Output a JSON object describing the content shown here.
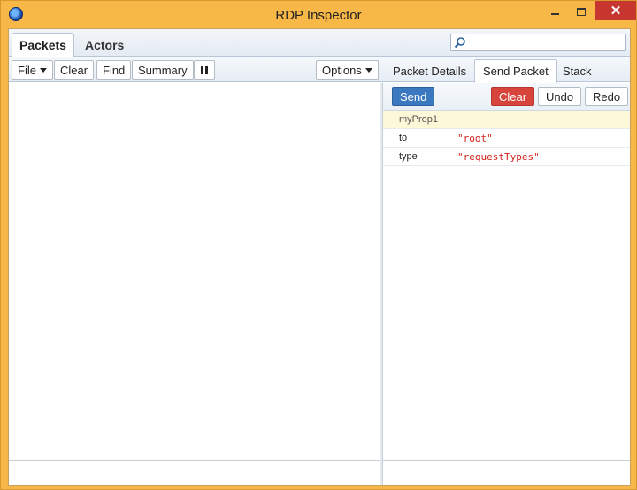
{
  "window": {
    "title": "RDP Inspector",
    "close_glyph": "✕"
  },
  "main_tabs": [
    {
      "label": "Packets"
    },
    {
      "label": "Actors"
    }
  ],
  "search": {
    "placeholder": ""
  },
  "toolbar": {
    "file_label": "File",
    "clear_label": "Clear",
    "find_label": "Find",
    "summary_label": "Summary",
    "options_label": "Options"
  },
  "side_tabs": [
    {
      "label": "Packet Details"
    },
    {
      "label": "Send Packet"
    },
    {
      "label": "Stack"
    }
  ],
  "send_panel": {
    "send_label": "Send",
    "clear_label": "Clear",
    "undo_label": "Undo",
    "redo_label": "Redo",
    "new_prop_placeholder": "myProp1",
    "props": [
      {
        "key": "to",
        "value": "\"root\""
      },
      {
        "key": "type",
        "value": "\"requestTypes\""
      }
    ]
  },
  "colors": {
    "frame": "#f8b848",
    "send": "#3a78c0",
    "clear": "#d6443c",
    "string_value": "#d2211a"
  }
}
